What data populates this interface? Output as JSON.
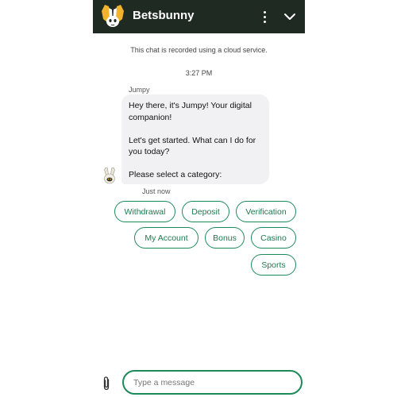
{
  "header": {
    "brand": "Betsbunny",
    "logo_icon": "bunny-logo-icon",
    "menu_icon": "more-vertical-icon",
    "collapse_icon": "chevron-down-icon",
    "background_color": "#1f2a22",
    "logo_color": "#f2b22c"
  },
  "notice": "This chat is recorded using a cloud service.",
  "timestamp": "3:27 PM",
  "message": {
    "sender": "Jumpy",
    "line1": "Hey there, it's Jumpy! Your digital companion!",
    "line2": "Let's get started. What can I do for you today?",
    "line3": "Please select a category:",
    "time": "Just now",
    "avatar_icon": "bunny-avatar-icon"
  },
  "categories": [
    "Withdrawal",
    "Deposit",
    "Verification",
    "My Account",
    "Bonus",
    "Casino",
    "Sports"
  ],
  "composer": {
    "placeholder": "Type a message",
    "attach_icon": "paperclip-icon",
    "accent_color": "#1d8a5a"
  }
}
